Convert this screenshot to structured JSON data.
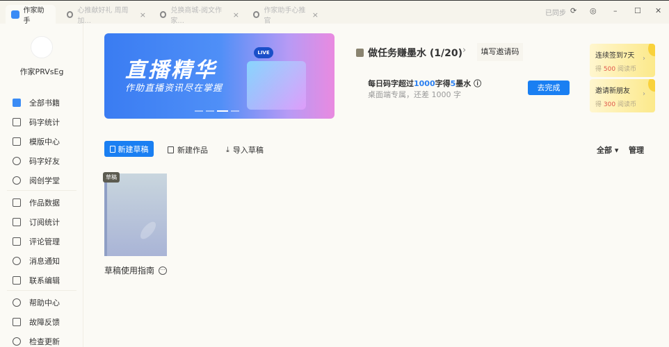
{
  "titlebar": {
    "tabs": [
      {
        "label": "作家助手"
      },
      {
        "label": "心推献好礼 周周加..."
      },
      {
        "label": "兑换商城-阅文作家..."
      },
      {
        "label": "作家助手心推官"
      }
    ],
    "sync_status": "已同步",
    "close_glyph": "×"
  },
  "sidebar": {
    "username": "作家PRVsEg",
    "items": [
      {
        "label": "全部书籍"
      },
      {
        "label": "码字统计"
      },
      {
        "label": "模版中心"
      },
      {
        "label": "码字好友"
      },
      {
        "label": "阅创学堂"
      },
      {
        "label": "作品数据"
      },
      {
        "label": "订阅统计"
      },
      {
        "label": "评论管理"
      },
      {
        "label": "消息通知"
      },
      {
        "label": "联系编辑"
      },
      {
        "label": "帮助中心"
      },
      {
        "label": "故障反馈"
      },
      {
        "label": "检查更新"
      }
    ]
  },
  "banner": {
    "title": "直播精华",
    "subtitle": "作助直播资讯尽在掌握",
    "live": "LIVE"
  },
  "task": {
    "title": "做任务赚墨水 (1/20)",
    "invite_label": "填写邀请码",
    "line_prefix": "每日码字超过",
    "line_n1": "1000",
    "line_mid": "字得",
    "line_n2": "5",
    "line_suffix": "墨水 ⓘ",
    "sub": "桌面端专属，还差 1000 字",
    "go_label": "去完成"
  },
  "promos": [
    {
      "title": "连续签到7天",
      "pre": "得",
      "amount": "500",
      "post": "阅读币"
    },
    {
      "title": "邀请新朋友",
      "pre": "得",
      "amount": "300",
      "post": "阅读币"
    }
  ],
  "toolbar": {
    "new_draft": "新建草稿",
    "new_work": "新建作品",
    "import": "导入草稿",
    "filter": "全部 ▾",
    "manage": "管理"
  },
  "books": [
    {
      "badge": "草稿",
      "title": "草稿使用指南"
    }
  ]
}
